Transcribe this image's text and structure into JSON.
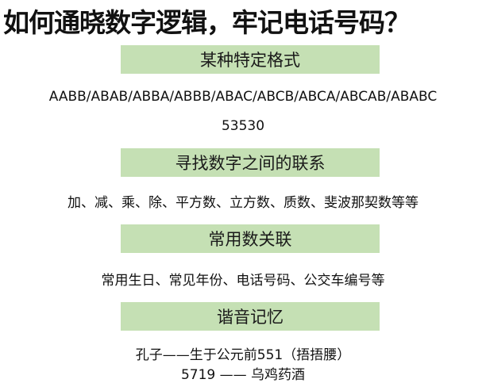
{
  "title": "如何通晓数字逻辑，牢记电话号码？",
  "sections": [
    {
      "heading": "某种特定格式",
      "lines": [
        "AABB/ABAB/ABBA/ABBB/ABAC/ABCB/ABCA/ABCAB/ABABC",
        "53530"
      ]
    },
    {
      "heading": "寻找数字之间的联系",
      "lines": [
        "加、减、乘、除、平方数、立方数、质数、斐波那契数等等"
      ]
    },
    {
      "heading": "常用数关联",
      "lines": [
        "常用生日、常见年份、电话号码、公交车编号等"
      ]
    },
    {
      "heading": "谐音记忆",
      "lines": [
        "孔子——生于公元前551（捂捂腰）",
        "5719 —— 乌鸡药酒"
      ]
    }
  ],
  "colors": {
    "heading_bg": "#c5e0b4"
  }
}
